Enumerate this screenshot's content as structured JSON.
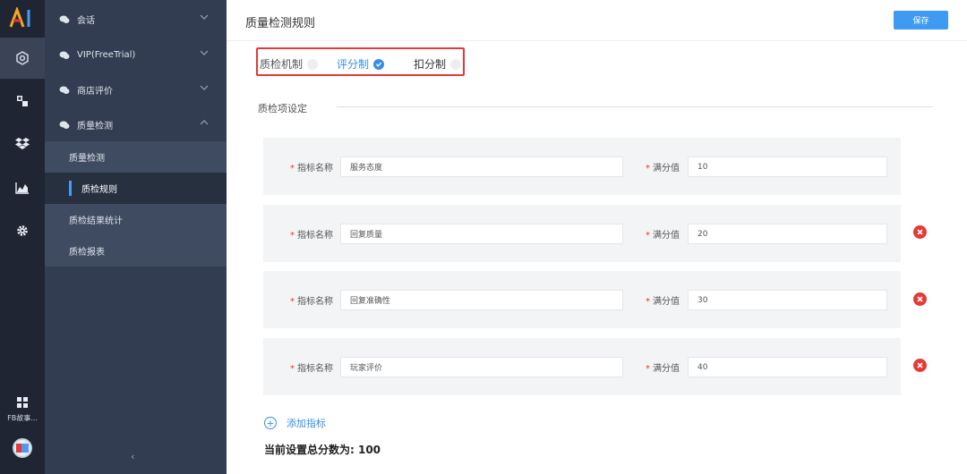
{
  "brand": {
    "logo_text": "AI"
  },
  "rail": {
    "items": [
      {
        "icon": "settings-hex-icon",
        "active": true
      },
      {
        "icon": "dashboard-icon",
        "active": false
      },
      {
        "icon": "dropbox-icon",
        "active": false
      },
      {
        "icon": "area-chart-icon",
        "active": false
      },
      {
        "icon": "gear-icon",
        "active": false
      }
    ],
    "app_label": "FB故事...",
    "avatar_icon": "avatar-icon"
  },
  "menu": {
    "groups": [
      {
        "label": "会话",
        "expanded": false
      },
      {
        "label": "VIP(FreeTrial)",
        "expanded": false
      },
      {
        "label": "商店评价",
        "expanded": false
      },
      {
        "label": "质量检测",
        "expanded": true
      }
    ],
    "sub_items": [
      {
        "label": "质量检测",
        "active": false
      },
      {
        "label": "质检规则",
        "active": true
      },
      {
        "label": "质检结果统计",
        "active": false
      },
      {
        "label": "质检报表",
        "active": false
      }
    ],
    "collapse_label": "‹"
  },
  "header": {
    "title": "质量检测规则",
    "save_label": "保存"
  },
  "mechanism": {
    "options": [
      {
        "label": "质检机制",
        "selected": false
      },
      {
        "label": "评分制",
        "selected": true
      },
      {
        "label": "扣分制",
        "selected": false
      }
    ]
  },
  "section": {
    "title": "质检项设定"
  },
  "indicators": {
    "name_label": "指标名称",
    "score_label": "满分值",
    "required_mark": "*",
    "rows": [
      {
        "name": "服务态度",
        "score": "10",
        "removable": false
      },
      {
        "name": "回复质量",
        "score": "20",
        "removable": true
      },
      {
        "name": "回复准确性",
        "score": "30",
        "removable": true
      },
      {
        "name": "玩家评价",
        "score": "40",
        "removable": true
      }
    ]
  },
  "add_label": "添加指标",
  "total_label": "当前设置总分数为: 100",
  "colors": {
    "accent": "#3f9bf1",
    "danger": "#e53935",
    "rail": "#1f2532",
    "menu": "#323d51"
  }
}
